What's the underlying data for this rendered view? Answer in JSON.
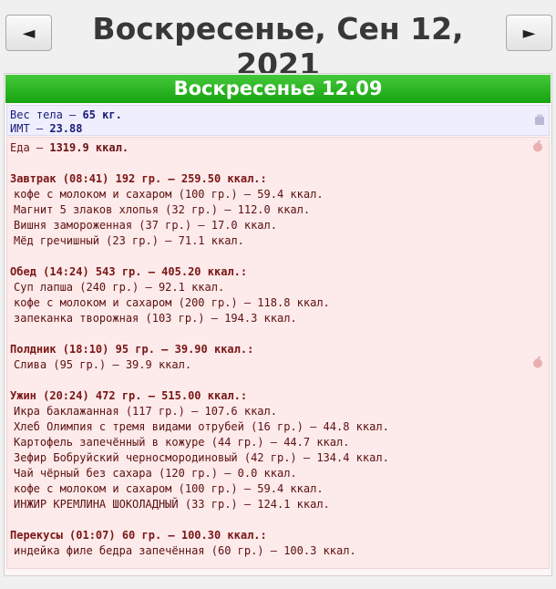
{
  "nav": {
    "prev_label": "◄",
    "next_label": "►",
    "date_title": "Воскресенье, Сен 12, 2021"
  },
  "day_header": "Воскресенье 12.09",
  "body": {
    "weight_label": "Вес тела — ",
    "weight_value": "65 кг.",
    "bmi_label": "ИМТ — ",
    "bmi_value": "23.88"
  },
  "food": {
    "total_label": "Еда — ",
    "total_value": "1319.9 ккал.",
    "meals": [
      {
        "header": "Завтрак (08:41) 192 гр. — 259.50 ккал.:",
        "items": [
          "кофе с молоком и сахаром (100 гр.) — 59.4 ккал.",
          "Магнит 5 злаков хлопья (32 гр.) — 112.0 ккал.",
          "Вишня замороженная (37 гр.) — 17.0 ккал.",
          "Мёд гречишный (23 гр.) — 71.1 ккал."
        ]
      },
      {
        "header": "Обед (14:24) 543 гр. — 405.20 ккал.:",
        "items": [
          "Суп лапша (240 гр.) — 92.1 ккал.",
          "кофе с молоком и сахаром (200 гр.) — 118.8 ккал.",
          "запеканка творожная (103 гр.) — 194.3 ккал."
        ]
      },
      {
        "header": "Полдник (18:10) 95 гр. — 39.90 ккал.:",
        "items": [
          "Слива (95 гр.) — 39.9 ккал."
        ]
      },
      {
        "header": "Ужин (20:24) 472 гр. — 515.00 ккал.:",
        "items": [
          "Икра баклажанная (117 гр.) — 107.6 ккал.",
          "Хлеб Олимпия с тремя видами отрубей (16 гр.) — 44.8 ккал.",
          "Картофель запечённый в кожуре (44 гр.) — 44.7 ккал.",
          "Зефир Бобруйский черносмородиновый (42 гр.) — 134.4 ккал.",
          "Чай чёрный без сахара (120 гр.) — 0.0 ккал.",
          "кофе с молоком и сахаром (100 гр.) — 59.4 ккал.",
          "ИНЖИР КРЕМЛИНА ШОКОЛАДНЫЙ (33 гр.) — 124.1 ккал."
        ]
      },
      {
        "header": "Перекусы (01:07) 60 гр. — 100.30 ккал.:",
        "items": [
          "индейка филе бедра запечённая (60 гр.) — 100.3 ккал."
        ]
      }
    ]
  },
  "icons": {
    "scale": "scale-icon",
    "apple": "apple-icon"
  }
}
